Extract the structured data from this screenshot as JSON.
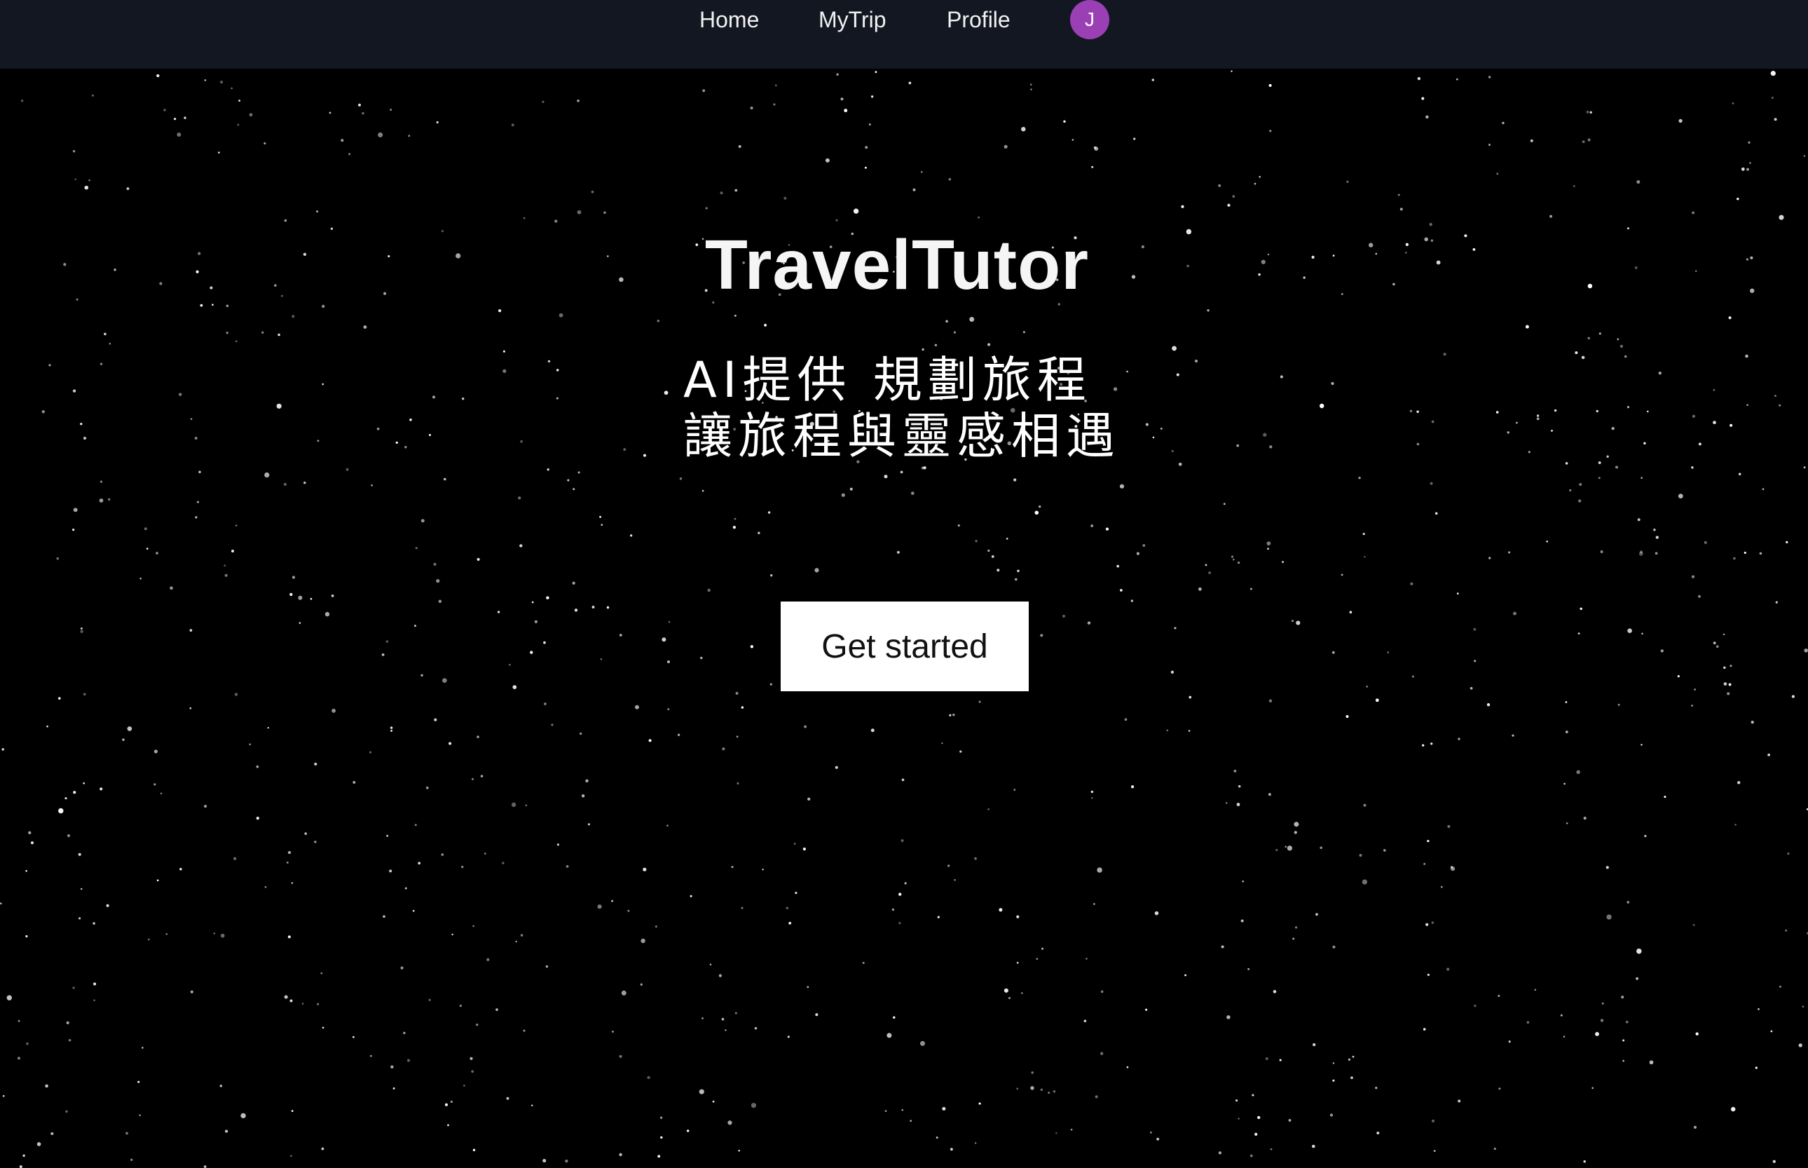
{
  "nav": {
    "items": [
      {
        "label": "Home"
      },
      {
        "label": "MyTrip"
      },
      {
        "label": "Profile"
      }
    ],
    "avatar_initial": "J"
  },
  "hero": {
    "title": "TravelTutor",
    "subtitle_lines": [
      "AI提供 規劃旅程",
      "讓旅程與靈感相遇"
    ],
    "cta_label": "Get started"
  },
  "colors": {
    "navbar_bg": "#131722",
    "page_bg": "#000000",
    "avatar_bg": "#9b3fb5",
    "cta_bg": "#ffffff",
    "text": "#ffffff"
  },
  "icons": {
    "background": "starfield"
  }
}
